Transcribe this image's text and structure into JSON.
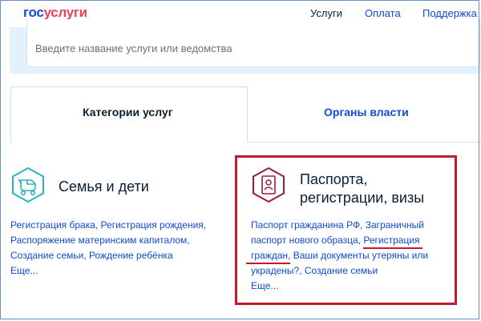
{
  "header": {
    "logo_part1": "гос",
    "logo_part2": "услуги",
    "nav": [
      "Услуги",
      "Оплата",
      "Поддержка"
    ]
  },
  "search": {
    "placeholder": "Введите название услуги или ведомства"
  },
  "tabs": [
    {
      "label": "Категории услуг",
      "active": true
    },
    {
      "label": "Органы власти",
      "active": false
    }
  ],
  "categories": [
    {
      "title_line1": "Семья и дети",
      "icon": "baby-stroller-icon",
      "links_text": "Регистрация брака, Регистрация рождения, Распоряжение материнским капиталом, Создание семьи, Рождение ребёнка",
      "more": "Еще..."
    },
    {
      "title_line1": "Паспорта,",
      "title_line2": "регистрации, визы",
      "icon": "passport-icon",
      "links_part1": "Паспорт гражданина РФ, Заграничный паспорт нового образца, ",
      "links_highlight": "Регистрация граждан",
      "links_part2": ", Ваши документы утеряны или украдены?, Создание семьи",
      "more": "Еще..."
    }
  ],
  "colors": {
    "brand_blue": "#0d4cd3",
    "brand_red": "#ee3f58",
    "annotation_red": "#c5192d",
    "teal": "#2bb3c0",
    "burgundy": "#9b1b45"
  }
}
